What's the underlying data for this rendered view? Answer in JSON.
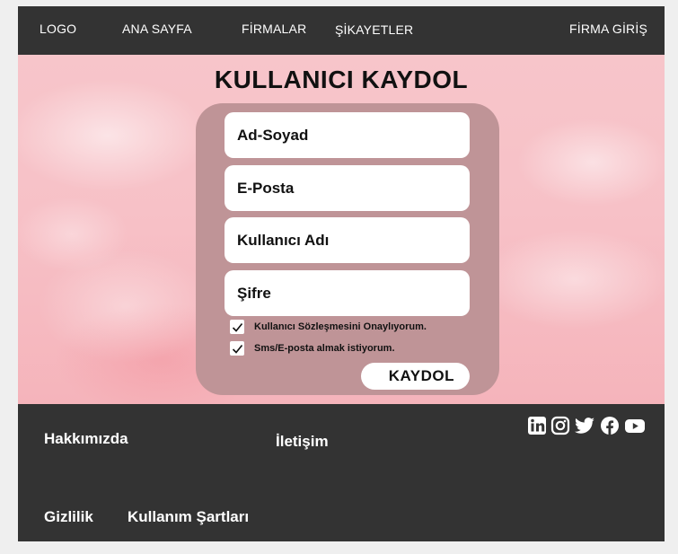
{
  "nav": {
    "logo": "LOGO",
    "items": [
      "ANA SAYFA",
      "FİRMALAR",
      "ŞİKAYETLER"
    ],
    "login": "FİRMA GİRİŞ"
  },
  "form": {
    "title": "KULLANICI KAYDOL",
    "fields": [
      "Ad-Soyad",
      "E-Posta",
      "Kullanıcı Adı",
      "Şifre"
    ],
    "checks": [
      {
        "label": "Kullanıcı Sözleşmesini Onaylıyorum.",
        "checked": true
      },
      {
        "label": "Sms/E-posta almak istiyorum.",
        "checked": true
      }
    ],
    "submit": "KAYDOL"
  },
  "footer": {
    "about": "Hakkımızda",
    "contact": "İletişim",
    "privacy": "Gizlilik",
    "terms": "Kullanım Şartları",
    "social": [
      "linkedin-icon",
      "instagram-icon",
      "twitter-icon",
      "facebook-icon",
      "youtube-icon"
    ]
  },
  "colors": {
    "nav_bg": "#333333",
    "hero_pink": "#f7c1c7",
    "card": "#bf9497",
    "footer_bg": "#333333"
  }
}
